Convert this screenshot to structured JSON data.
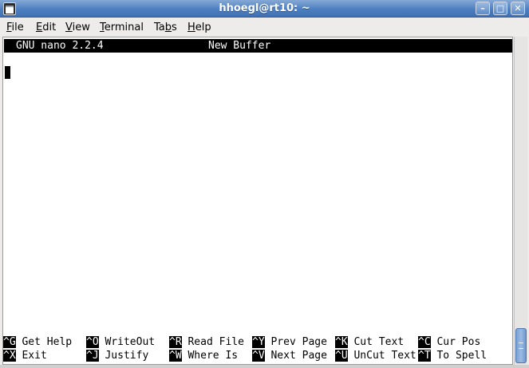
{
  "window": {
    "title": "hhoegl@rt10: ~",
    "buttons": {
      "minimize": "–",
      "maximize": "□",
      "close": "✕"
    }
  },
  "menu": [
    {
      "first": "F",
      "rest": "ile"
    },
    {
      "first": "E",
      "rest": "dit"
    },
    {
      "first": "V",
      "rest": "iew"
    },
    {
      "first": "T",
      "rest": "erminal"
    },
    {
      "first": "Ta",
      "under": "b",
      "rest": "s"
    },
    {
      "first": "H",
      "rest": "elp"
    }
  ],
  "nano": {
    "version": "GNU nano 2.2.4",
    "buffer": "New Buffer"
  },
  "shortcuts": [
    {
      "key": "^G",
      "label": "Get Help"
    },
    {
      "key": "^O",
      "label": "WriteOut"
    },
    {
      "key": "^R",
      "label": "Read File"
    },
    {
      "key": "^Y",
      "label": "Prev Page"
    },
    {
      "key": "^K",
      "label": "Cut Text"
    },
    {
      "key": "^C",
      "label": "Cur Pos"
    },
    {
      "key": "^X",
      "label": "Exit"
    },
    {
      "key": "^J",
      "label": "Justify"
    },
    {
      "key": "^W",
      "label": "Where Is"
    },
    {
      "key": "^V",
      "label": "Next Page"
    },
    {
      "key": "^U",
      "label": "UnCut Text"
    },
    {
      "key": "^T",
      "label": "To Spell"
    }
  ]
}
